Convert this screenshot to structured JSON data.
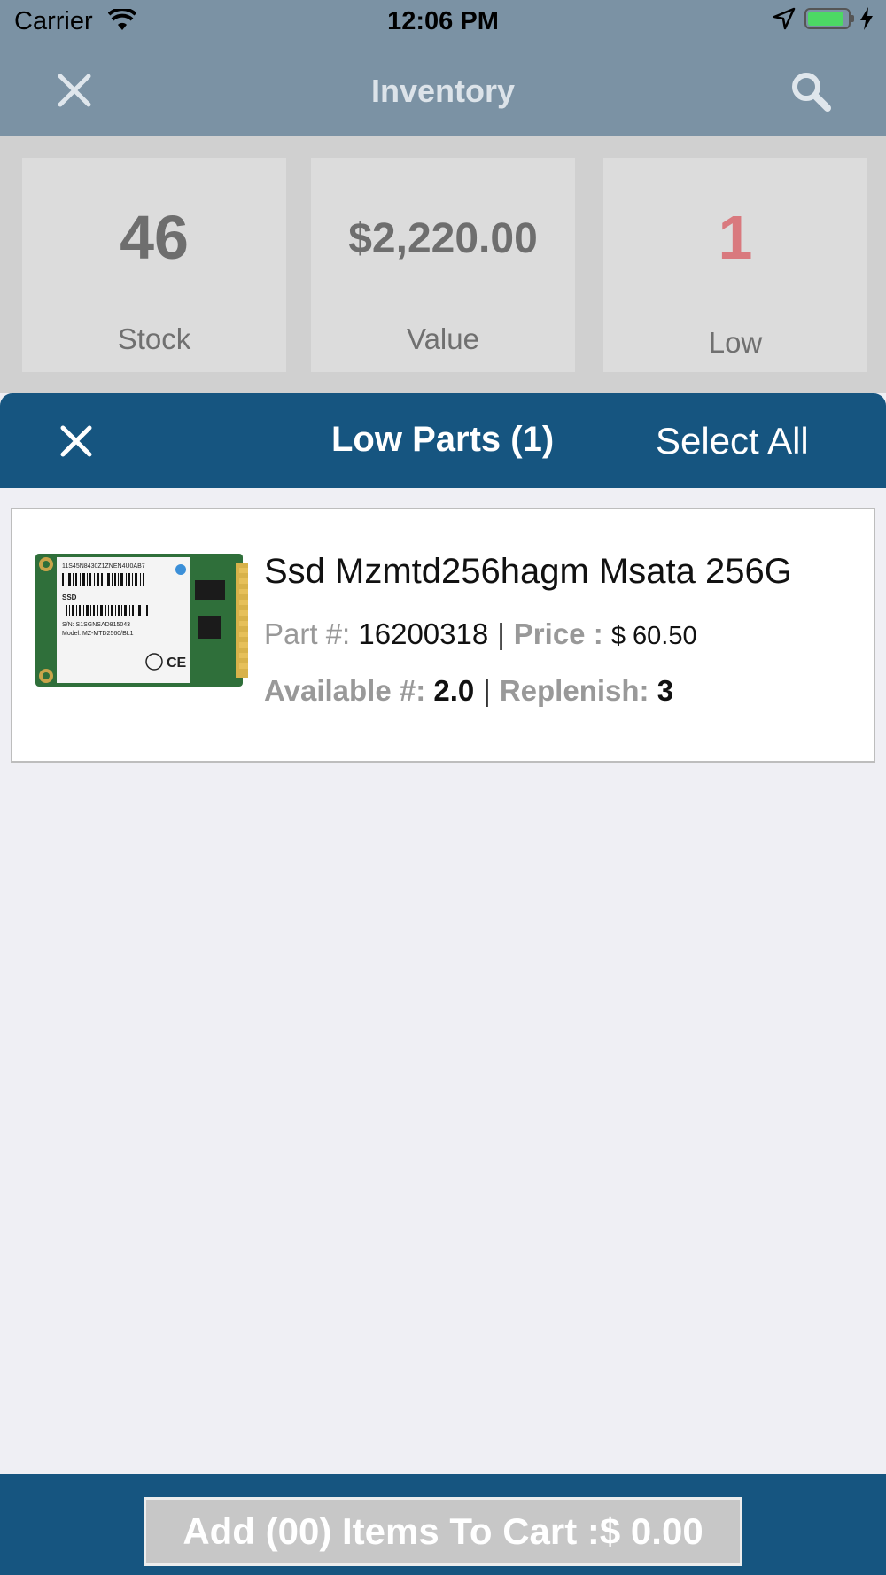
{
  "status_bar": {
    "carrier": "Carrier",
    "time": "12:06 PM"
  },
  "header": {
    "title": "Inventory",
    "close_icon": "close-icon",
    "search_icon": "search-icon"
  },
  "stats": {
    "stock_value": "46",
    "stock_label": "Stock",
    "money_value": "$2,220.00",
    "money_label": "Value",
    "low_value": "1",
    "low_label": "Low",
    "low_color": "#d9797e"
  },
  "panel": {
    "title": "Low Parts (1)",
    "select_all": "Select All",
    "color": "#165580"
  },
  "parts": [
    {
      "name": "Ssd Mzmtd256hagm Msata 256G",
      "part_label": "Part #:",
      "part_number": "16200318",
      "price_label": "Price :",
      "price": "$ 60.50",
      "available_label": "Available #:",
      "available": "2.0",
      "replenish_label": "Replenish:",
      "replenish": "3",
      "image": {
        "line1": "11S45N8430Z1ZNEN4U0AB7",
        "line2": "S/N: S1SGNSAD815043",
        "line3": "Model: MZ-MTD2560/BL1",
        "line4": "SSD",
        "mark": "CE"
      }
    }
  ],
  "footer": {
    "cart_button": "Add (00) Items To Cart :$ 0.00"
  }
}
